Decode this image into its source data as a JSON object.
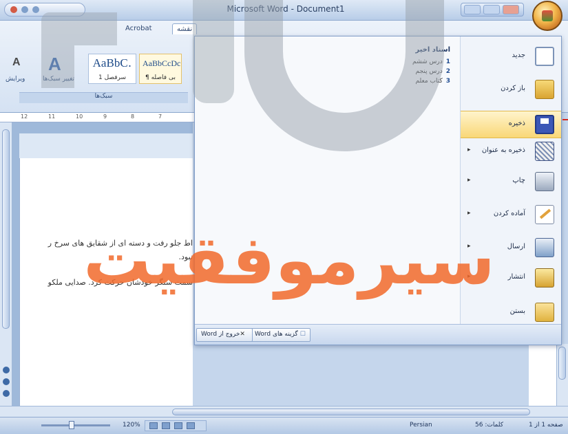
{
  "window": {
    "title": "Microsoft Word - Document1"
  },
  "ribbon": {
    "tab_home": "نقشه",
    "tab_acrobat": "Acrobat",
    "styles": [
      {
        "preview": "AaBbC․",
        "caption": "سرفصل 1"
      },
      {
        "preview": "AaBbCcDc",
        "caption": "¶ بی فاصله"
      }
    ],
    "group_label": "سبک‌ها",
    "change_styles": "تغییر سبک‌ها",
    "editing": "ویرایش",
    "small_items": [
      "««",
      "««",
      "««"
    ]
  },
  "document": {
    "line1": "اط جلو رفت و دسته ای از شقایق های سرخ ر",
    "line2": "نبود.",
    "line3": "سمت سنگر خودشان حرکت کرد. صدایی ملکو"
  },
  "office_menu": {
    "recent_title": "اسناد اخیر",
    "recent_items": [
      {
        "num": "1",
        "name": "درس ششم"
      },
      {
        "num": "2",
        "name": "درس پنجم"
      },
      {
        "num": "3",
        "name": "کتاب معلم"
      }
    ],
    "commands": [
      {
        "label": "جدید",
        "arrow": "",
        "icon": "new-document-icon"
      },
      {
        "label": "باز کردن",
        "arrow": "",
        "icon": "open-folder-icon"
      },
      {
        "label": "ذخیره",
        "arrow": "",
        "icon": "save-icon"
      },
      {
        "label": "ذخیره به عنوان",
        "arrow": "▸",
        "icon": "save-as-icon"
      },
      {
        "label": "چاپ",
        "arrow": "▸",
        "icon": "print-icon"
      },
      {
        "label": "آماده کردن",
        "arrow": "▸",
        "icon": "prepare-icon"
      },
      {
        "label": "ارسال",
        "arrow": "▸",
        "icon": "send-icon"
      },
      {
        "label": "انتشار",
        "arrow": "▸",
        "icon": "publish-icon"
      },
      {
        "label": "بستن",
        "arrow": "",
        "icon": "close-document-icon"
      }
    ],
    "selected_index": 2,
    "options_button": "گزینه های Word",
    "exit_button": "خروج از Word"
  },
  "statusbar": {
    "page": "صفحه 1 از 1",
    "words": "کلمات: 56",
    "language": "Persian",
    "zoom": "120%"
  },
  "watermark": {
    "text": "سیرموفقیت"
  },
  "colors": {
    "accent_selected": "#f9d777",
    "watermark": "#f26a2c"
  }
}
